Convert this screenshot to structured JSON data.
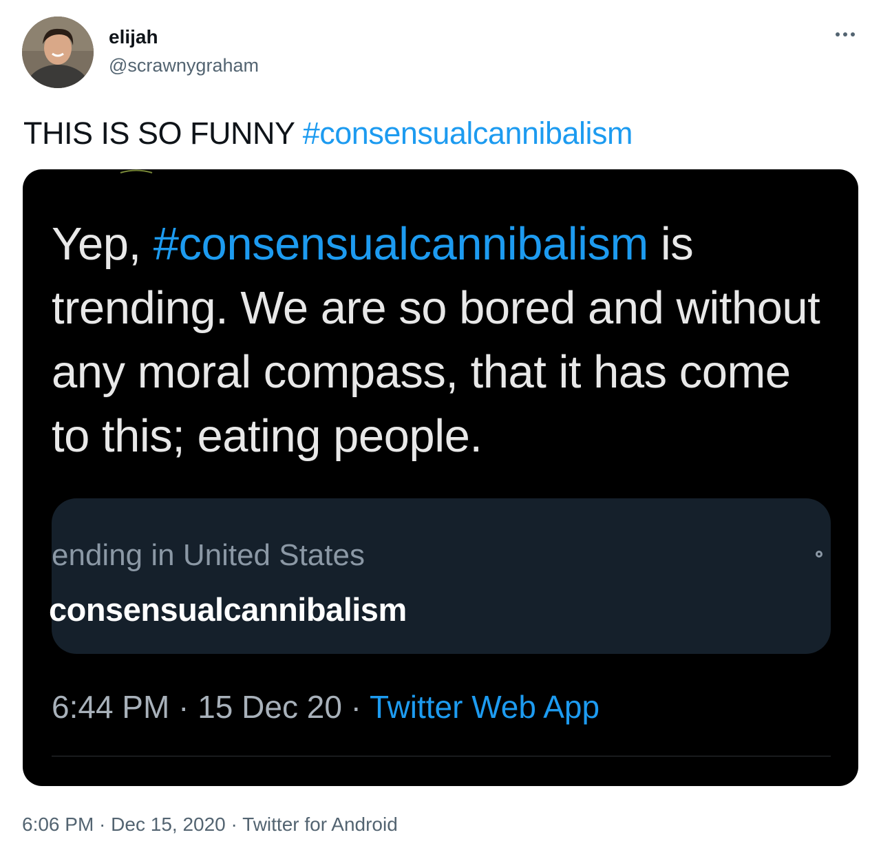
{
  "author": {
    "display_name": "elijah",
    "handle": "@scrawnygraham",
    "avatar_icon": "user-avatar"
  },
  "tweet": {
    "text": "THIS IS SO FUNNY ",
    "hashtag": "#consensualcannibalism"
  },
  "embedded": {
    "text_prefix": "Yep, ",
    "hashtag": "#consensualcannibalism",
    "text_body": " is trending. We are so bored and without any moral compass, that it has come to this; eating people.",
    "trend_location": "ending in United States",
    "trend_name": "consensualcannibalism",
    "time": "6:44 PM",
    "sep1": " · ",
    "date": "15 Dec 20",
    "sep2": " · ",
    "source": "Twitter Web App"
  },
  "meta": {
    "time": "6:06 PM",
    "sep1": " · ",
    "date": "Dec 15, 2020",
    "sep2": " · ",
    "source": "Twitter for Android"
  },
  "colors": {
    "link": "#1d9bf0",
    "secondary_text": "#536471",
    "media_bg": "#000000",
    "trend_card_bg": "#15202b"
  }
}
